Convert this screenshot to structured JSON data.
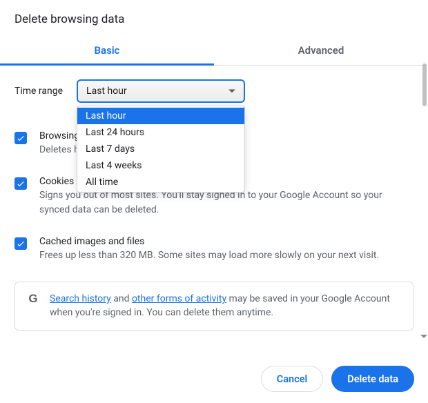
{
  "dialog": {
    "title": "Delete browsing data"
  },
  "tabs": {
    "basic": "Basic",
    "advanced": "Advanced"
  },
  "time_range": {
    "label": "Time range",
    "selected": "Last hour",
    "options": [
      "Last hour",
      "Last 24 hours",
      "Last 7 days",
      "Last 4 weeks",
      "All time"
    ]
  },
  "items": [
    {
      "title": "Browsing history",
      "desc": "Deletes history, including in the search box"
    },
    {
      "title": "Cookies and other site data",
      "desc": "Signs you out of most sites. You'll stay signed in to your Google Account so your synced data can be deleted."
    },
    {
      "title": "Cached images and files",
      "desc": "Frees up less than 320 MB. Some sites may load more slowly on your next visit."
    }
  ],
  "notice": {
    "link1": "Search history",
    "mid1": " and ",
    "link2": "other forms of activity",
    "rest": " may be saved in your Google Account when you're signed in. You can delete them anytime."
  },
  "buttons": {
    "cancel": "Cancel",
    "confirm": "Delete data"
  }
}
